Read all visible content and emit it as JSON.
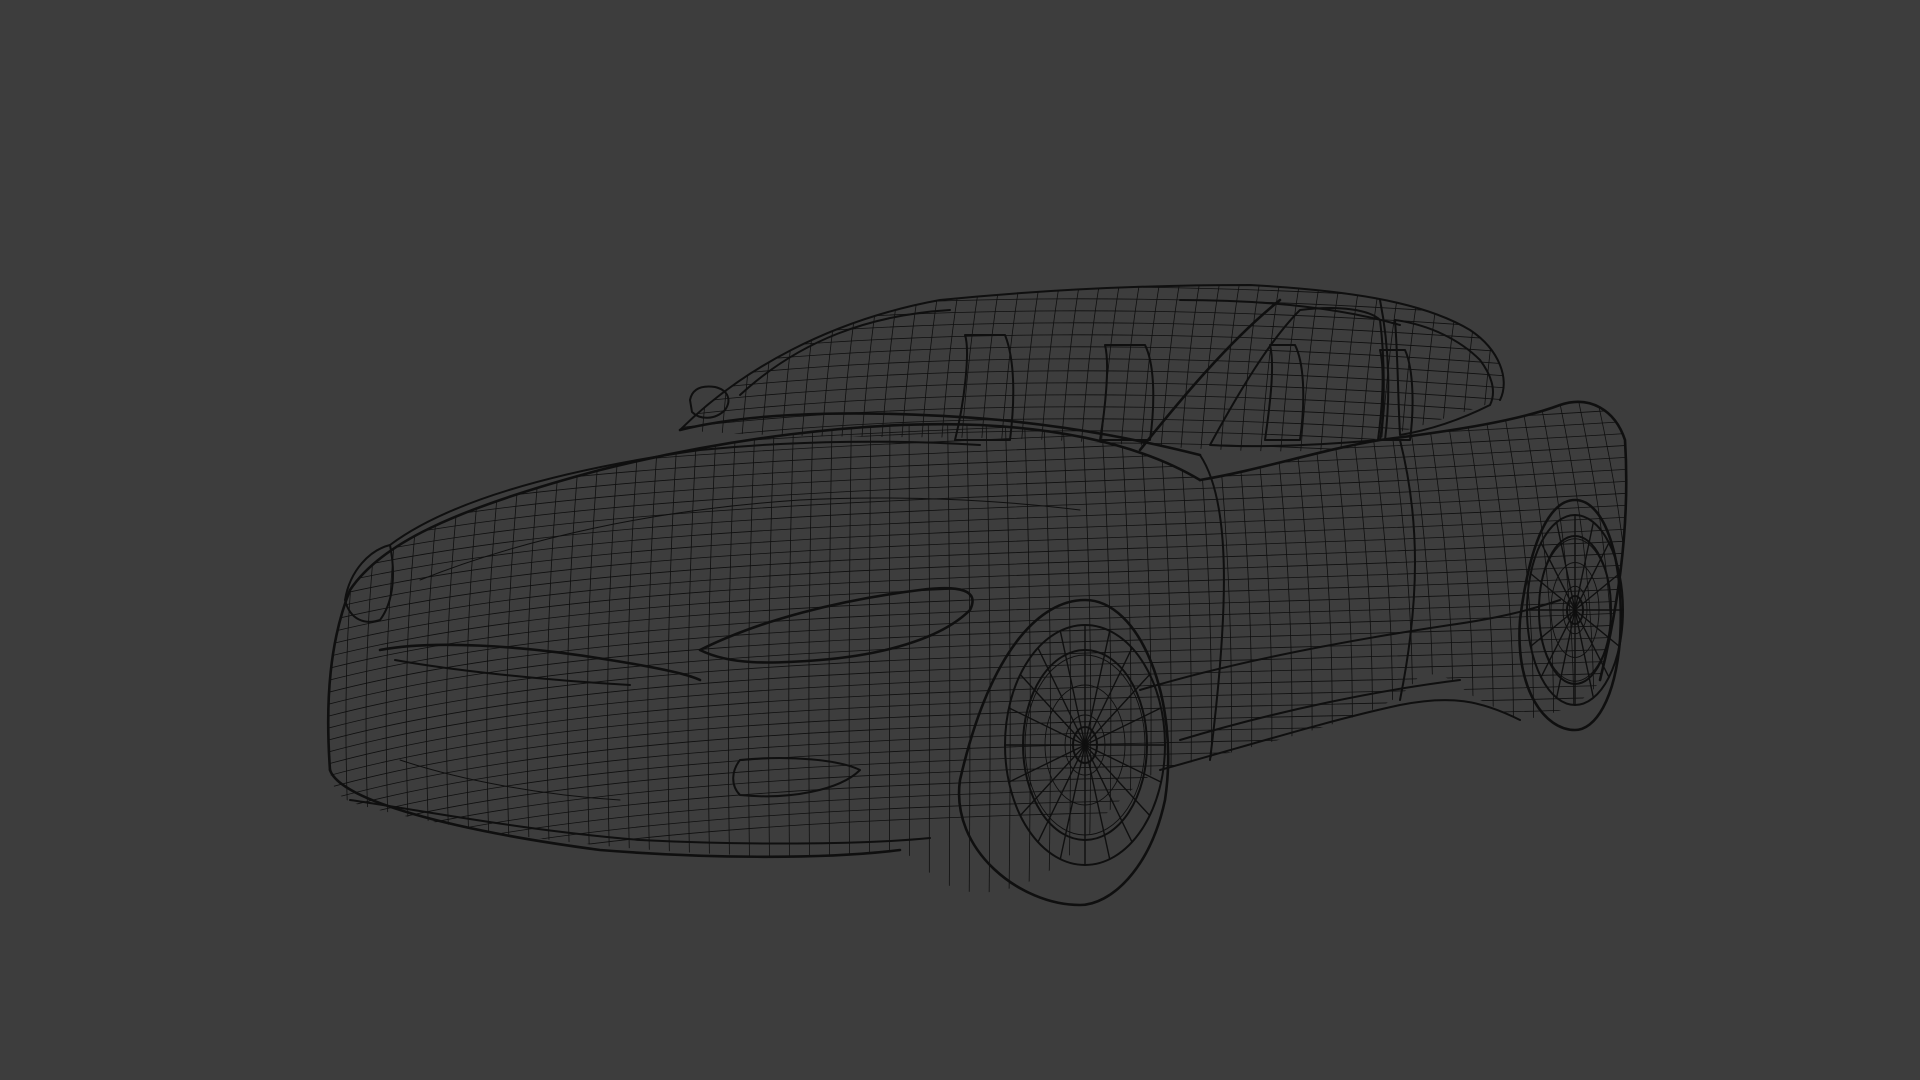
{
  "viewport": {
    "background_color": "#3d3d3d",
    "wire_color": "#0f0f0f",
    "subject": "wireframe-car"
  }
}
